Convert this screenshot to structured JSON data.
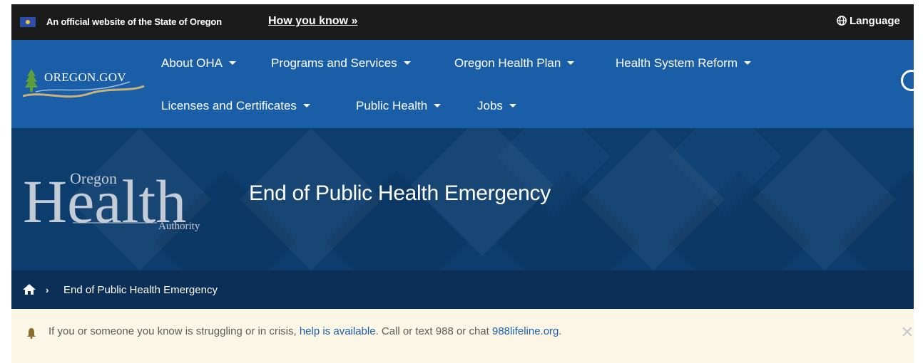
{
  "topbar": {
    "official_text": "An official website of the State of Oregon",
    "how_link": "How you know »",
    "language_label": "Language"
  },
  "nav": {
    "logo_text": "OREGON.GOV",
    "items": [
      {
        "label": "About OHA"
      },
      {
        "label": "Programs and Services"
      },
      {
        "label": "Oregon Health Plan"
      },
      {
        "label": "Health System Reform"
      },
      {
        "label": "Licenses and Certificates"
      },
      {
        "label": "Public Health"
      },
      {
        "label": "Jobs"
      }
    ]
  },
  "hero": {
    "logo_big": "Health",
    "logo_top": "Oregon",
    "logo_bottom": "Authority",
    "title": "End of Public Health Emergency"
  },
  "breadcrumb": {
    "separator": "›",
    "current": "End of Public Health Emergency"
  },
  "alert": {
    "text_before": "If you or someone you know is struggling or in crisis, ",
    "help_link": "help is available",
    "text_middle": ". Call or text 988 or chat ",
    "lifeline_link": "988lifeline.org",
    "text_after": ".",
    "close_symbol": "✕"
  },
  "colors": {
    "topbar_bg": "#1b1b1b",
    "nav_bg": "#1a5ea8",
    "hero_bg": "#0c3d6d",
    "breadcrumb_bg": "#0b2f56",
    "alert_bg": "#fcf6e6",
    "link": "#1c5fa8"
  },
  "icons": [
    "oregon-flag-icon",
    "globe-icon",
    "chevron-down-icon",
    "search-icon",
    "home-icon",
    "bell-icon",
    "close-icon"
  ]
}
